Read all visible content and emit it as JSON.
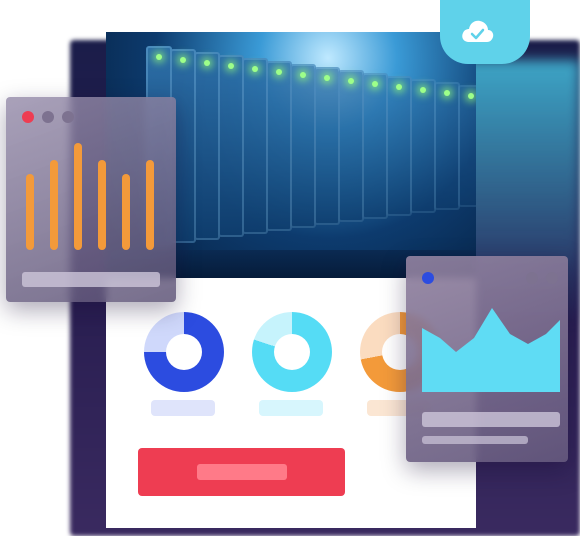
{
  "illustration": {
    "theme": "cloud-server-monitoring",
    "colors": {
      "accent_red": "#ee3d52",
      "accent_blue": "#2c4ce0",
      "accent_cyan": "#55dcf5",
      "accent_orange": "#f39a3a",
      "cloud_badge": "#5fd2ea"
    }
  },
  "cloud_badge": {
    "icon": "cloud-check-icon"
  },
  "left_panel": {
    "window_dots": [
      "red",
      "gray",
      "gray"
    ],
    "bar_levels": [
      0.66,
      0.78,
      0.93,
      0.78,
      0.66,
      0.78
    ]
  },
  "donuts": [
    {
      "color": "#2c4ce0",
      "fill": 0.75
    },
    {
      "color": "#55dcf5",
      "fill": 0.8
    },
    {
      "color": "#f39a3a",
      "fill": 0.72
    }
  ],
  "right_panel": {
    "window_dots": [
      "blue",
      "gray",
      "gray"
    ],
    "chart_icon": "area-chart-icon"
  },
  "primary_action": {
    "icon": "placeholder-bar"
  }
}
